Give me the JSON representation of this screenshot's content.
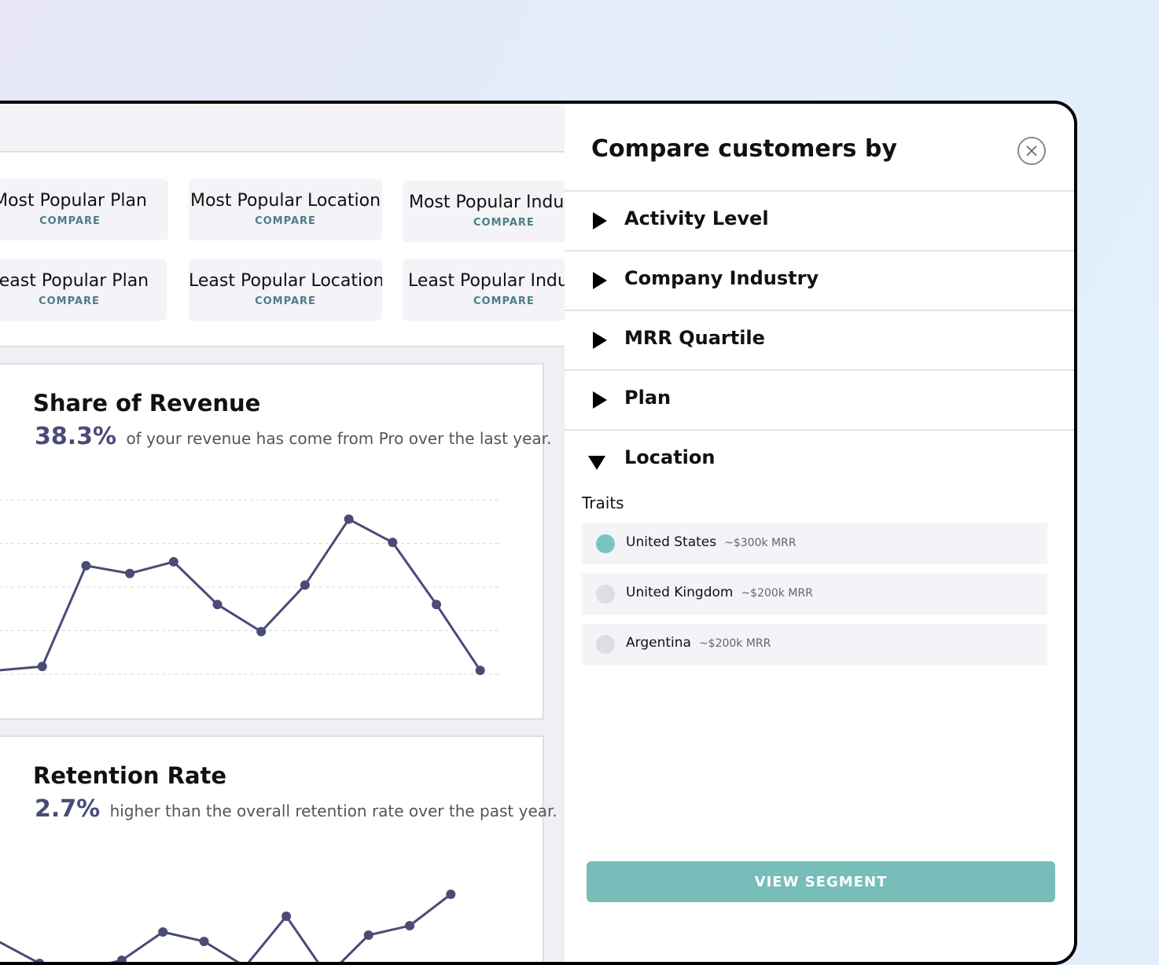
{
  "cards": [
    {
      "title": "Most Popular Plan",
      "action": "COMPARE"
    },
    {
      "title": "Most Popular Location",
      "action": "COMPARE"
    },
    {
      "title": "Most Popular Indus",
      "action": "COMPARE"
    },
    {
      "title": "Least Popular Plan",
      "action": "COMPARE"
    },
    {
      "title": "Least Popular Location",
      "action": "COMPARE"
    },
    {
      "title": "Least Popular Indus",
      "action": "COMPARE"
    }
  ],
  "revenue": {
    "title": "Share of Revenue",
    "pct": "38.3%",
    "text": "of your revenue has come from Pro over the last year."
  },
  "retention": {
    "title": "Retention Rate",
    "pct": "2.7%",
    "text": "higher than the overall retention rate over the past year."
  },
  "chart_data": [
    {
      "type": "line",
      "x": [
        0,
        1,
        2,
        3,
        4,
        5,
        6,
        7,
        8,
        9,
        10,
        11
      ],
      "series": [
        {
          "values": [
            0.1,
            0.2,
            2.8,
            2.6,
            2.9,
            1.8,
            1.1,
            2.3,
            4.0,
            3.4,
            1.8,
            0.1
          ]
        }
      ],
      "ylim": [
        0,
        4.5
      ],
      "grid": true,
      "color": "#4b4b78"
    },
    {
      "type": "line",
      "x": [
        0,
        1,
        2,
        3,
        4,
        5,
        6,
        7,
        8,
        9,
        10,
        11
      ],
      "series": [
        {
          "values": [
            1.5,
            0.8,
            0.6,
            0.9,
            1.8,
            1.5,
            0.7,
            2.3,
            0.4,
            1.7,
            2.0,
            3.0
          ]
        }
      ],
      "ylim": [
        0,
        4
      ],
      "color": "#4b4b78"
    }
  ],
  "panel": {
    "title": "Compare customers by",
    "categories": [
      "Activity Level",
      "Company Industry",
      "MRR Quartile",
      "Plan",
      "Location"
    ],
    "traits_label": "Traits",
    "traits": [
      {
        "name": "United States",
        "mrr": "~$300k MRR",
        "color": "#7cc4c0"
      },
      {
        "name": "United Kingdom",
        "mrr": "~$200k MRR",
        "color": "#dddde3"
      },
      {
        "name": "Argentina",
        "mrr": "~$200k MRR",
        "color": "#dddde3"
      }
    ],
    "button": "VIEW SEGMENT"
  },
  "colors": {
    "accent": "#77bdb9",
    "compare": "#4e7d85",
    "line": "#4b4b78"
  }
}
